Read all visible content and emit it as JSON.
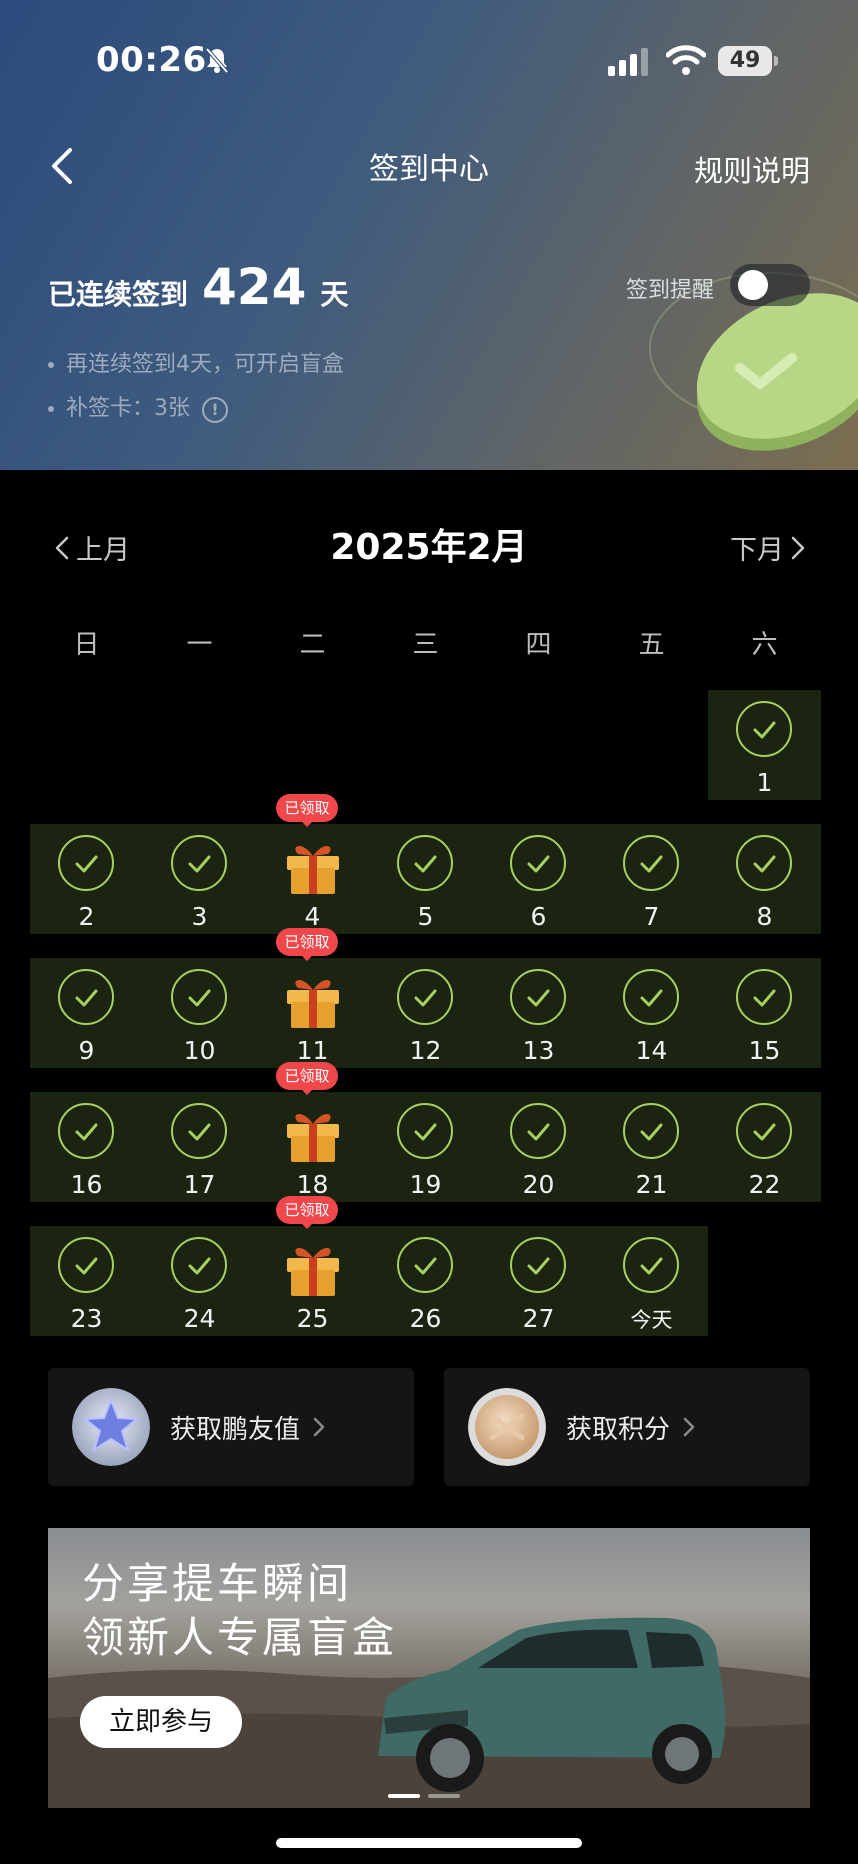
{
  "status_bar": {
    "time": "00:26",
    "battery": "49"
  },
  "nav": {
    "title": "签到中心",
    "rules_label": "规则说明"
  },
  "streak": {
    "prefix": "已连续签到",
    "days": "424",
    "suffix": "天"
  },
  "reminder": {
    "label": "签到提醒",
    "enabled": false
  },
  "info": {
    "line1": "再连续签到4天，可开启盲盒",
    "line2": "补签卡：3张",
    "info_icon": "!"
  },
  "calendar": {
    "title": "2025年2月",
    "prev_label": "上月",
    "next_label": "下月",
    "weekdays": [
      "日",
      "一",
      "二",
      "三",
      "四",
      "五",
      "六"
    ],
    "claimed_label": "已领取",
    "weeks": [
      [
        "",
        "",
        "",
        "",
        "",
        "",
        "1"
      ],
      [
        "2",
        "3",
        "4",
        "5",
        "6",
        "7",
        "8"
      ],
      [
        "9",
        "10",
        "11",
        "12",
        "13",
        "14",
        "15"
      ],
      [
        "16",
        "17",
        "18",
        "19",
        "20",
        "21",
        "22"
      ],
      [
        "23",
        "24",
        "25",
        "26",
        "27",
        "今天",
        ""
      ]
    ],
    "gift_days": [
      "4",
      "11",
      "18",
      "25"
    ]
  },
  "cards": [
    {
      "label": "获取鹏友值",
      "icon": "star-crystal-icon"
    },
    {
      "label": "获取积分",
      "icon": "coin-icon"
    }
  ],
  "banner": {
    "line1": "分享提车瞬间",
    "line2": "领新人专属盲盒",
    "button": "立即参与",
    "slide_index": 1,
    "slide_count": 2
  },
  "colors": {
    "check": "#a7d060",
    "calendar_row": "#1b2410",
    "badge": "#f0474b"
  }
}
